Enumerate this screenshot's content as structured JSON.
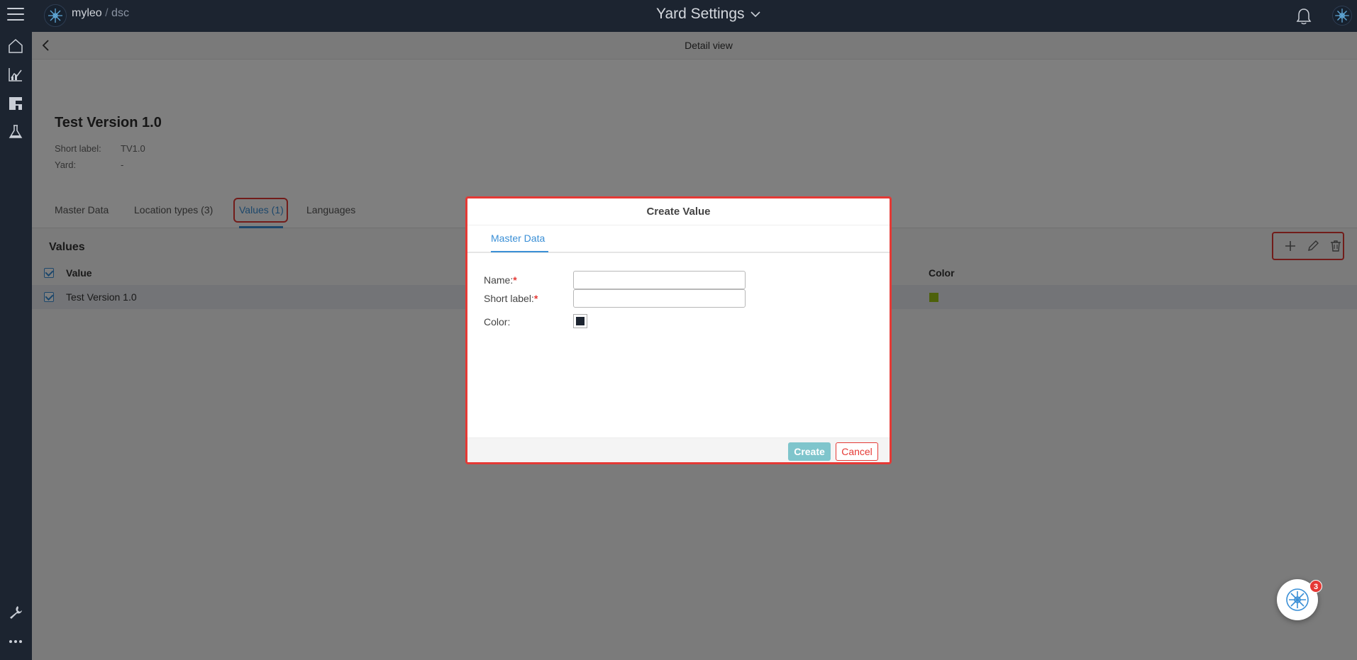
{
  "topbar": {
    "brand_name": "myleo",
    "brand_sep": "/",
    "brand_suffix": "dsc",
    "app_title": "Yard Settings",
    "icons": [
      "menu-icon",
      "logo-icon",
      "chevron-down-icon",
      "bell-icon",
      "user-logo-icon"
    ]
  },
  "sidebar": {
    "items": [
      "home-icon",
      "analytics-icon",
      "dashboard-icon",
      "lab-flask-icon"
    ],
    "bottom_items": [
      "wrench-icon",
      "more-icon"
    ]
  },
  "subheader": {
    "title": "Detail view"
  },
  "detail": {
    "title": "Test Version 1.0",
    "short_label_caption": "Short label:",
    "short_label_value": "TV1.0",
    "yard_caption": "Yard:",
    "yard_value": "-"
  },
  "tabs": [
    {
      "label": "Master Data"
    },
    {
      "label": "Location types (3)"
    },
    {
      "label": "Values (1)",
      "active": true
    },
    {
      "label": "Languages"
    }
  ],
  "values_table": {
    "section_title": "Values",
    "columns": [
      "Value",
      "Color"
    ],
    "rows": [
      {
        "value": "Test Version 1.0",
        "color": "#9bc216",
        "checked": true
      }
    ],
    "toolbar_icons": [
      "add-icon",
      "edit-icon",
      "delete-icon"
    ]
  },
  "dialog": {
    "title": "Create Value",
    "tab": "Master Data",
    "fields": {
      "name_label": "Name:",
      "name_value": "",
      "short_label_label": "Short label:",
      "short_label_value": "",
      "color_label": "Color:",
      "color_value": "#1c2430"
    },
    "required_marker": "*",
    "create_label": "Create",
    "cancel_label": "Cancel"
  },
  "assistant": {
    "badge_count": "3"
  },
  "colors": {
    "accent": "#3a8fd6",
    "highlight": "#e53935",
    "topbar": "#1c2430",
    "create_button": "#7fc5cc"
  }
}
